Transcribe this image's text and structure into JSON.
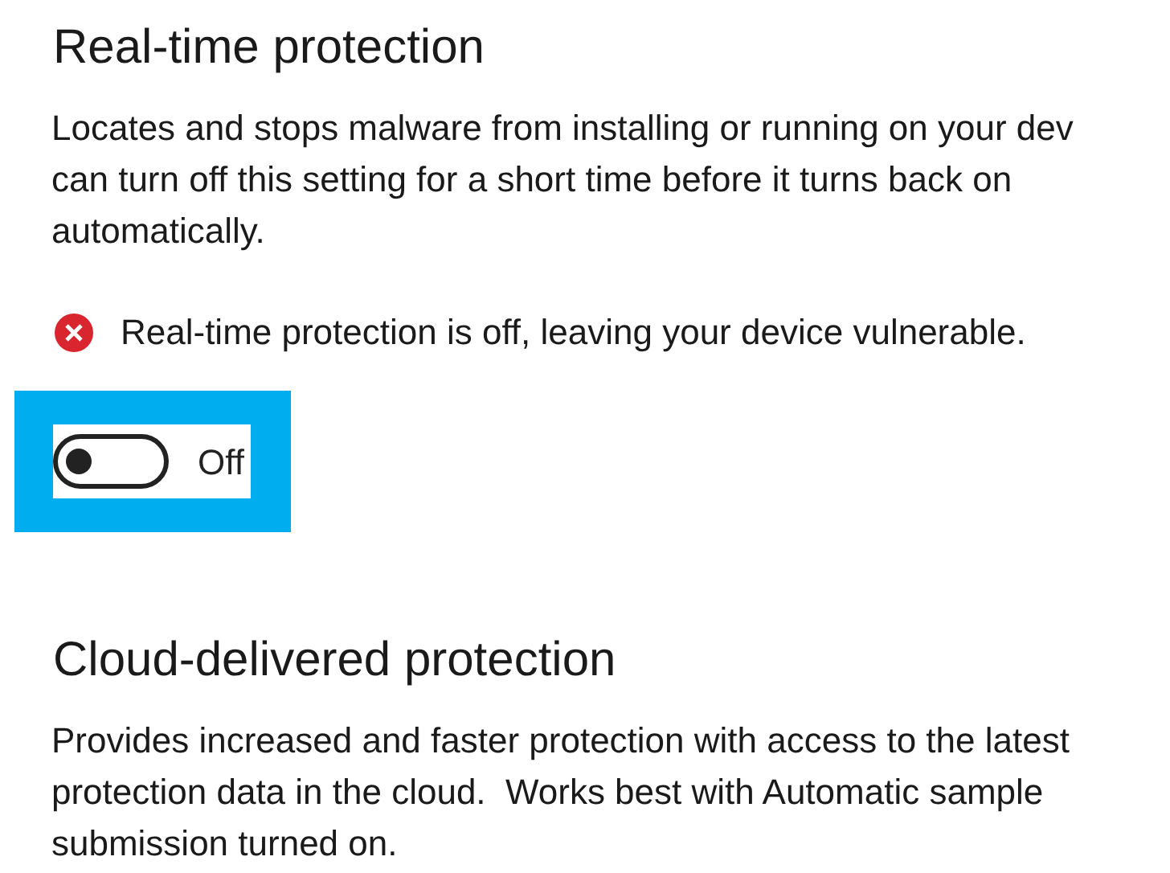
{
  "sections": [
    {
      "title": "Real-time protection",
      "description_lines": [
        "Locates and stops malware from installing or running on your dev",
        "can turn off this setting for a short time before it turns back on",
        "automatically."
      ],
      "warning": "Real-time protection is off, leaving your device vulnerable.",
      "toggle": {
        "on": false,
        "label": "Off",
        "highlighted": true
      }
    },
    {
      "title": "Cloud-delivered protection",
      "description_lines": [
        "Provides increased and faster protection with access to the latest",
        "protection data in the cloud.  Works best with Automatic sample",
        "submission turned on."
      ]
    }
  ]
}
